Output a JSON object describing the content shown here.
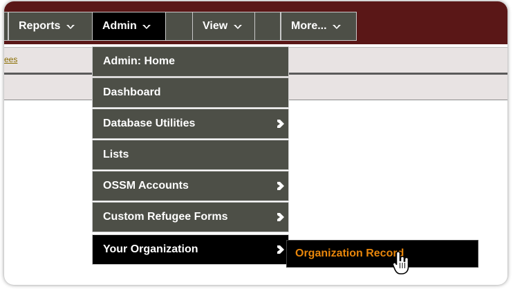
{
  "nav": {
    "reports": "Reports",
    "admin": "Admin",
    "view": "View",
    "more": "More..."
  },
  "strip": {
    "link_fragment": "ees"
  },
  "admin_menu": {
    "items": [
      {
        "label": "Admin: Home",
        "has_submenu": false
      },
      {
        "label": "Dashboard",
        "has_submenu": false
      },
      {
        "label": "Database Utilities",
        "has_submenu": true
      },
      {
        "label": "Lists",
        "has_submenu": false
      },
      {
        "label": "OSSM Accounts",
        "has_submenu": true
      },
      {
        "label": "Custom Refugee Forms",
        "has_submenu": true
      },
      {
        "label": "Your Organization",
        "has_submenu": true,
        "active": true
      }
    ]
  },
  "submenu": {
    "item": "Organization Record"
  },
  "colors": {
    "topbar": "#5a1717",
    "menu_bg": "#4d4f47",
    "active_bg": "#000000",
    "submenu_text": "#e8860b"
  },
  "icons": {
    "caret": "chevron-down-icon",
    "submenu_arrow": "chevron-right-icon",
    "cursor": "hand-pointer-icon"
  }
}
